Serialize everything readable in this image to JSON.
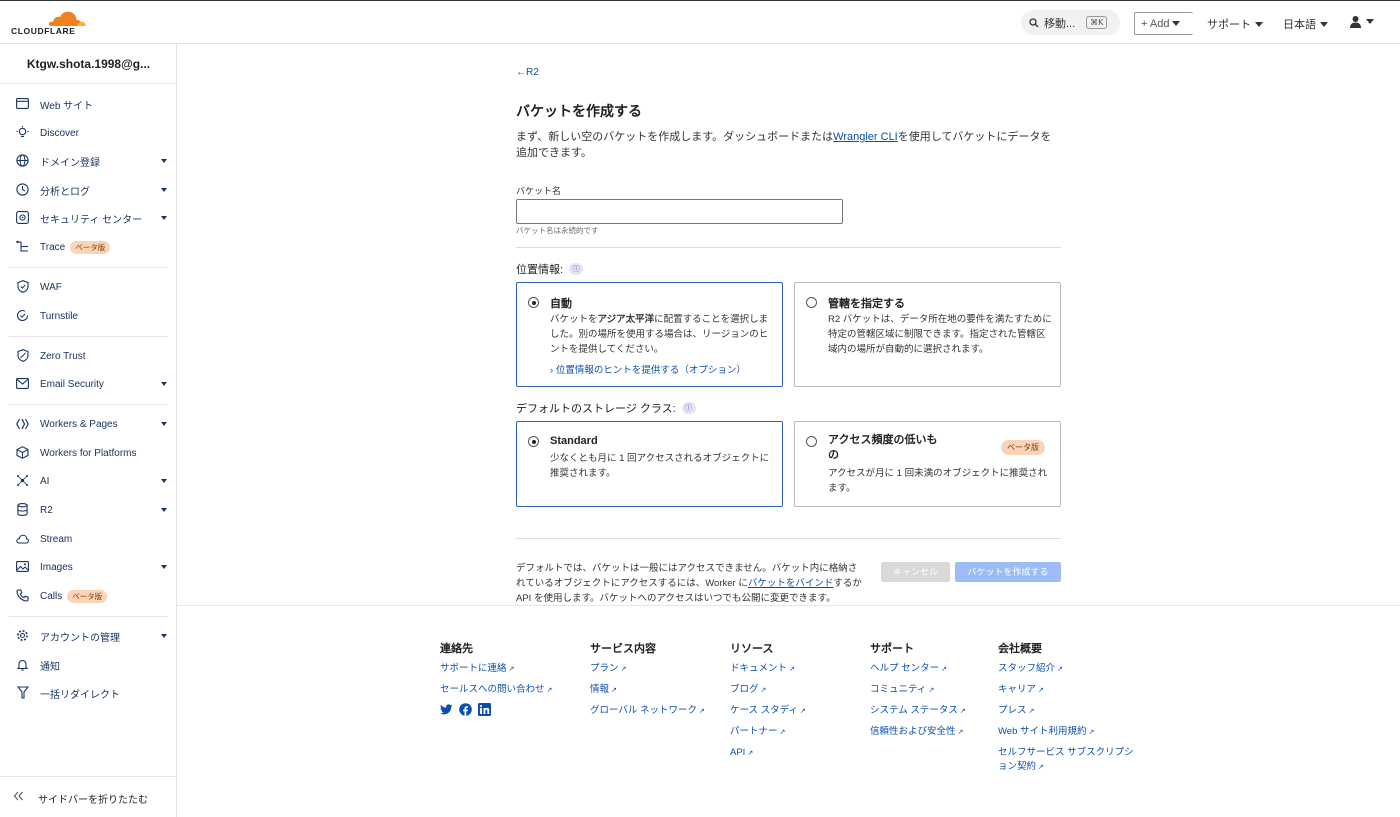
{
  "header": {
    "logo_text": "CLOUDFLARE",
    "search_label": "移動...",
    "search_shortcut": "⌘K",
    "add_label": "+ Add",
    "support_label": "サポート",
    "language_label": "日本語"
  },
  "sidebar": {
    "account": "Ktgw.shota.1998@g...",
    "items": [
      {
        "label": "Web サイト",
        "icon": "browser-icon"
      },
      {
        "label": "Discover",
        "icon": "lightbulb-icon"
      },
      {
        "label": "ドメイン登録",
        "icon": "globe-icon"
      },
      {
        "label": "分析とログ",
        "icon": "clock-chart-icon"
      },
      {
        "label": "セキュリティ センター",
        "icon": "radar-icon"
      },
      {
        "label": "Trace",
        "icon": "trace-icon",
        "badge": "ベータ版"
      },
      {
        "label": "WAF",
        "icon": "shield-icon"
      },
      {
        "label": "Turnstile",
        "icon": "turnstile-icon"
      },
      {
        "label": "Zero Trust",
        "icon": "zero-trust-icon"
      },
      {
        "label": "Email Security",
        "icon": "email-icon"
      },
      {
        "label": "Workers & Pages",
        "icon": "workers-icon"
      },
      {
        "label": "Workers for Platforms",
        "icon": "platforms-icon"
      },
      {
        "label": "AI",
        "icon": "ai-icon"
      },
      {
        "label": "R2",
        "icon": "database-icon"
      },
      {
        "label": "Stream",
        "icon": "cloud-icon"
      },
      {
        "label": "Images",
        "icon": "image-icon"
      },
      {
        "label": "Calls",
        "icon": "phone-icon",
        "badge": "ベータ版"
      },
      {
        "label": "アカウントの管理",
        "icon": "gear-icon"
      },
      {
        "label": "通知",
        "icon": "bell-icon"
      },
      {
        "label": "一括リダイレクト",
        "icon": "redirect-icon"
      }
    ],
    "collapse_label": "サイドバーを折りたたむ"
  },
  "main": {
    "back_link": "R2",
    "title": "バケットを作成する",
    "intro_before": "まず、新しい空のバケットを作成します。ダッシュボードまたは",
    "intro_link": "Wrangler CLI",
    "intro_after": "を使用してバケットにデータを追加できます。",
    "bucket_name_label": "バケット名",
    "bucket_name_value": "",
    "bucket_name_help": "バケット名は永続的です",
    "location_label": "位置情報:",
    "location_options": [
      {
        "title": "自動",
        "desc_1": "バケットを",
        "desc_bold": "アジア太平洋",
        "desc_2": "に配置することを選択しました。別の場所を使用する場合は、リージョンのヒントを提供してください。",
        "option_link": "位置情報のヒントを提供する（オプション）",
        "selected": true
      },
      {
        "title": "管轄を指定する",
        "desc": "R2 バケットは、データ所在地の要件を満たすために特定の管轄区域に制限できます。指定された管轄区域内の場所が自動的に選択されます。",
        "selected": false
      }
    ],
    "storage_label": "デフォルトのストレージ クラス:",
    "storage_options": [
      {
        "title": "Standard",
        "desc": "少なくとも月に 1 回アクセスされるオブジェクトに推奨されます。",
        "selected": true
      },
      {
        "title": "アクセス頻度の低いもの",
        "badge": "ベータ版",
        "desc": "アクセスが月に 1 回未満のオブジェクトに推奨されます。",
        "selected": false
      }
    ],
    "footer_note_before": "デフォルトでは、バケットは一般にはアクセスできません。バケット内に格納されているオブジェクトにアクセスするには、Worker に",
    "footer_note_link": "バケットをバインド",
    "footer_note_after": "するか API を使用します。バケットへのアクセスはいつでも公開に変更できます。",
    "cancel_label": "キャンセル",
    "create_label": "バケットを作成する"
  },
  "footer": {
    "columns": [
      {
        "heading": "連絡先",
        "links": [
          "サポートに連絡",
          "セールスへの問い合わせ"
        ]
      },
      {
        "heading": "サービス内容",
        "links": [
          "プラン",
          "情報",
          "グローバル ネットワーク"
        ]
      },
      {
        "heading": "リソース",
        "links": [
          "ドキュメント",
          "ブログ",
          "ケース スタディ",
          "パートナー",
          "API"
        ]
      },
      {
        "heading": "サポート",
        "links": [
          "ヘルプ センター",
          "コミュニティ",
          "システム ステータス",
          "信頼性および安全性"
        ]
      },
      {
        "heading": "会社概要",
        "links": [
          "スタッフ紹介",
          "キャリア",
          "プレス",
          "Web サイト利用規約",
          "セルフサービス サブスクリプション契約"
        ]
      }
    ],
    "social_icons": [
      "twitter-icon",
      "facebook-icon",
      "linkedin-icon"
    ]
  },
  "colors": {
    "brand_orange": "#f38020",
    "link_blue": "#0a4fb0",
    "selected_border": "#2e5fb4",
    "beta_badge": "#fbd3b6",
    "primary_disabled": "#9bbdf4"
  }
}
